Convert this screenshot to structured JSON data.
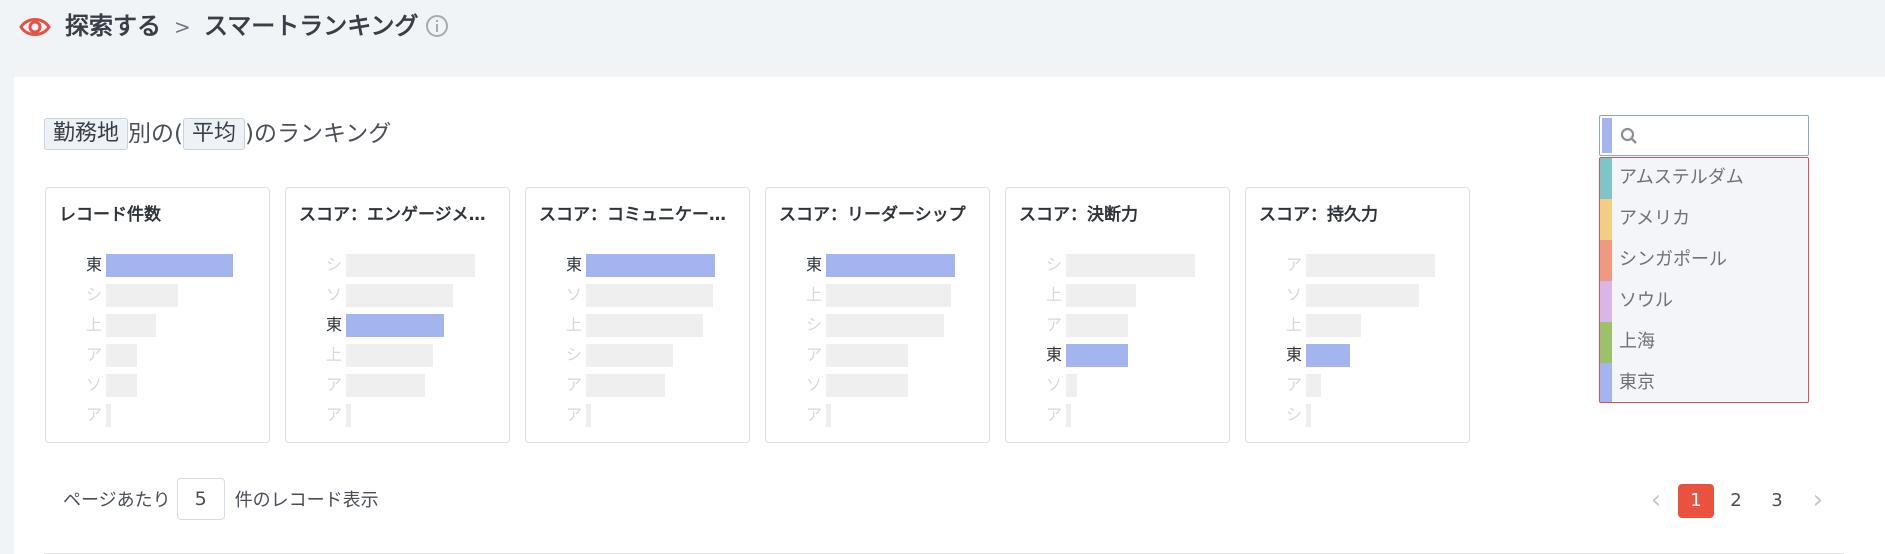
{
  "breadcrumb": {
    "explore": "探索する",
    "separator": ">",
    "current": "スマートランキング"
  },
  "heading": {
    "dimension": "勤務地",
    "text_between": "別の(",
    "metric": "平均",
    "text_after": ")のランキング"
  },
  "colors": {
    "highlight_bar": "#a3b4ee",
    "neutral_bar": "#efefef",
    "active_page": "#e8523f",
    "brand_eye": "#e2524a"
  },
  "rankings": [
    {
      "title": "レコード件数",
      "rows": [
        {
          "label": "東",
          "value": 0.95,
          "highlight": true
        },
        {
          "label": "シ",
          "value": 0.54,
          "highlight": false
        },
        {
          "label": "上",
          "value": 0.37,
          "highlight": false
        },
        {
          "label": "ア",
          "value": 0.23,
          "highlight": false
        },
        {
          "label": "ソ",
          "value": 0.23,
          "highlight": false
        },
        {
          "label": "ア",
          "value": 0.04,
          "highlight": false
        }
      ]
    },
    {
      "title": "スコア：エンゲージメ…",
      "rows": [
        {
          "label": "シ",
          "value": 0.96,
          "highlight": false
        },
        {
          "label": "ソ",
          "value": 0.8,
          "highlight": false
        },
        {
          "label": "東",
          "value": 0.73,
          "highlight": true
        },
        {
          "label": "上",
          "value": 0.65,
          "highlight": false
        },
        {
          "label": "ア",
          "value": 0.59,
          "highlight": false
        },
        {
          "label": "ア",
          "value": 0.04,
          "highlight": false
        }
      ]
    },
    {
      "title": "スコア：コミュニケー…",
      "rows": [
        {
          "label": "東",
          "value": 0.96,
          "highlight": true
        },
        {
          "label": "ソ",
          "value": 0.95,
          "highlight": false
        },
        {
          "label": "上",
          "value": 0.87,
          "highlight": false
        },
        {
          "label": "シ",
          "value": 0.65,
          "highlight": false
        },
        {
          "label": "ア",
          "value": 0.59,
          "highlight": false
        },
        {
          "label": "ア",
          "value": 0.04,
          "highlight": false
        }
      ]
    },
    {
      "title": "スコア：リーダーシップ",
      "rows": [
        {
          "label": "東",
          "value": 0.96,
          "highlight": true
        },
        {
          "label": "上",
          "value": 0.93,
          "highlight": false
        },
        {
          "label": "シ",
          "value": 0.88,
          "highlight": false
        },
        {
          "label": "ア",
          "value": 0.61,
          "highlight": false
        },
        {
          "label": "ソ",
          "value": 0.61,
          "highlight": false
        },
        {
          "label": "ア",
          "value": 0.04,
          "highlight": false
        }
      ]
    },
    {
      "title": "スコア：決断力",
      "rows": [
        {
          "label": "シ",
          "value": 0.96,
          "highlight": false
        },
        {
          "label": "上",
          "value": 0.52,
          "highlight": false
        },
        {
          "label": "ア",
          "value": 0.46,
          "highlight": false
        },
        {
          "label": "東",
          "value": 0.46,
          "highlight": true
        },
        {
          "label": "ソ",
          "value": 0.08,
          "highlight": false
        },
        {
          "label": "ア",
          "value": 0.04,
          "highlight": false
        }
      ]
    },
    {
      "title": "スコア：持久力",
      "rows": [
        {
          "label": "ア",
          "value": 0.96,
          "highlight": false
        },
        {
          "label": "ソ",
          "value": 0.84,
          "highlight": false
        },
        {
          "label": "上",
          "value": 0.41,
          "highlight": false
        },
        {
          "label": "東",
          "value": 0.33,
          "highlight": true
        },
        {
          "label": "ア",
          "value": 0.11,
          "highlight": false
        },
        {
          "label": "シ",
          "value": 0.04,
          "highlight": false
        }
      ]
    }
  ],
  "search": {
    "value": "",
    "placeholder": "",
    "icon": "search-icon"
  },
  "dropdown": {
    "items": [
      {
        "label": "アムステルダム",
        "color": "#7fc4c7"
      },
      {
        "label": "アメリカ",
        "color": "#f2ce82"
      },
      {
        "label": "シンガポール",
        "color": "#ee9a80"
      },
      {
        "label": "ソウル",
        "color": "#d9b6e8"
      },
      {
        "label": "上海",
        "color": "#9bc16a"
      },
      {
        "label": "東京",
        "color": "#a3b4ee"
      }
    ]
  },
  "pagination": {
    "per_page_prefix": "ページあたり",
    "per_page_value": "5",
    "per_page_suffix": "件のレコード表示",
    "prev": "‹",
    "next": "›",
    "pages": [
      "1",
      "2",
      "3"
    ],
    "current_page": "1"
  }
}
